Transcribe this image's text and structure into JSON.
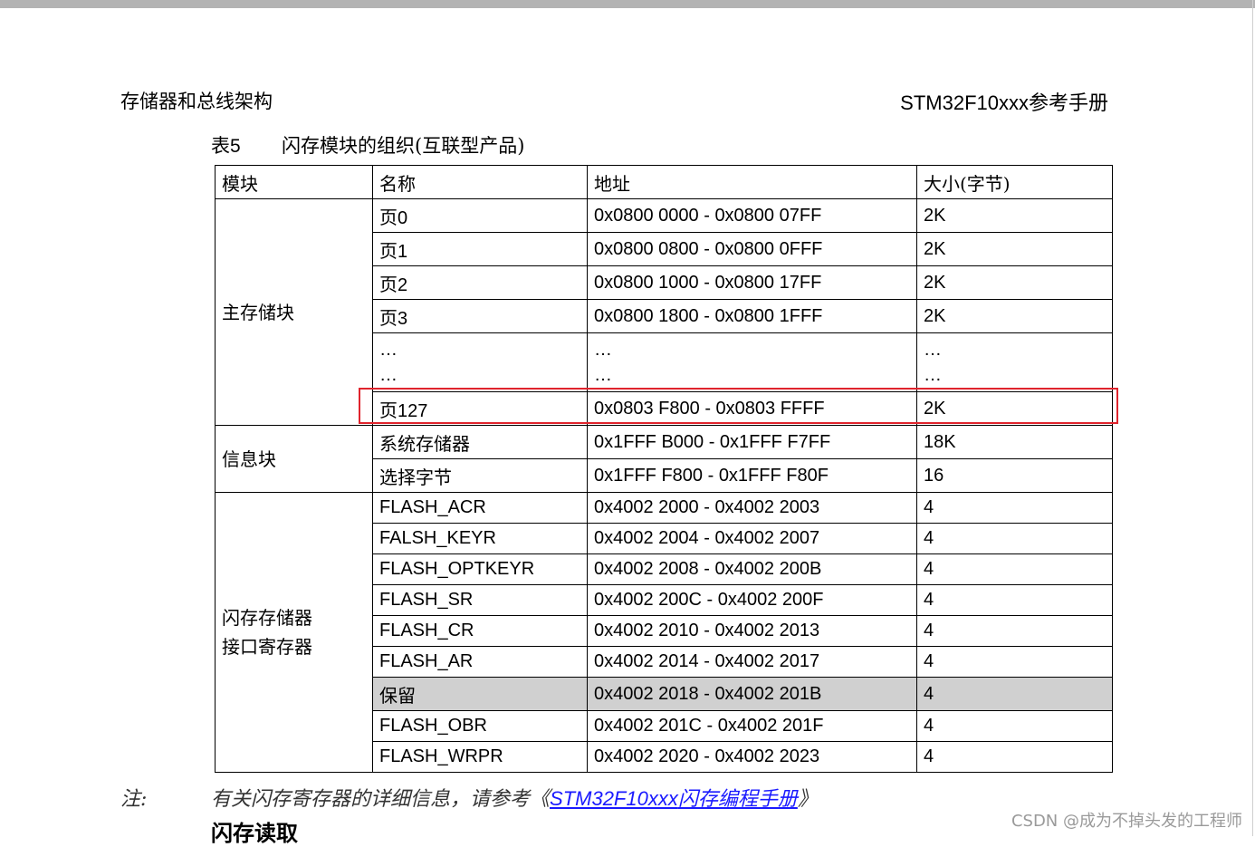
{
  "header": {
    "left": "存储器和总线架构",
    "right": "STM32F10xxx参考手册"
  },
  "caption": {
    "number": "表5",
    "title": "闪存模块的组织(互联型产品)"
  },
  "table": {
    "columns": [
      "模块",
      "名称",
      "地址",
      "大小(字节)"
    ],
    "main_block": {
      "label": "主存储块",
      "rows": [
        {
          "name": "页0",
          "addr": "0x0800 0000 - 0x0800 07FF",
          "size": "2K"
        },
        {
          "name": "页1",
          "addr": "0x0800 0800 - 0x0800 0FFF",
          "size": "2K"
        },
        {
          "name": "页2",
          "addr": "0x0800 1000 - 0x0800 17FF",
          "size": "2K"
        },
        {
          "name": "页3",
          "addr": "0x0800 1800 - 0x0800 1FFF",
          "size": "2K"
        }
      ],
      "ellipsis": "…",
      "last": {
        "name": "页127",
        "addr": "0x0803 F800 - 0x0803 FFFF",
        "size": "2K"
      }
    },
    "info_block": {
      "label": "信息块",
      "rows": [
        {
          "name": "系统存储器",
          "addr": "0x1FFF B000 - 0x1FFF F7FF",
          "size": "18K"
        },
        {
          "name": "选择字节",
          "addr": "0x1FFF F800 - 0x1FFF F80F",
          "size": "16"
        }
      ]
    },
    "reg_block": {
      "label_line1": "闪存存储器",
      "label_line2": "接口寄存器",
      "rows": [
        {
          "name": "FLASH_ACR",
          "addr": "0x4002 2000 - 0x4002 2003",
          "size": "4"
        },
        {
          "name": "FALSH_KEYR",
          "addr": "0x4002 2004 - 0x4002 2007",
          "size": "4"
        },
        {
          "name": "FLASH_OPTKEYR",
          "addr": "0x4002 2008 - 0x4002 200B",
          "size": "4"
        },
        {
          "name": "FLASH_SR",
          "addr": "0x4002 200C - 0x4002 200F",
          "size": "4"
        },
        {
          "name": "FLASH_CR",
          "addr": "0x4002 2010 - 0x4002 2013",
          "size": "4"
        },
        {
          "name": "FLASH_AR",
          "addr": "0x4002 2014 - 0x4002 2017",
          "size": "4"
        },
        {
          "name": "保留",
          "addr": "0x4002 2018 - 0x4002 201B",
          "size": "4"
        },
        {
          "name": "FLASH_OBR",
          "addr": "0x4002 201C - 0x4002 201F",
          "size": "4"
        },
        {
          "name": "FLASH_WRPR",
          "addr": "0x4002 2020 - 0x4002 2023",
          "size": "4"
        }
      ]
    }
  },
  "note": {
    "label": "注:",
    "text": "有关闪存寄存器的详细信息，请参考《",
    "link_latin": "STM32F10xxx",
    "link_cn": "闪存编程手册",
    "end": "》"
  },
  "section_title": "闪存读取",
  "watermark": "CSDN @成为不掉头发的工程师",
  "colors": {
    "highlight_box": "#e0242d",
    "reserved_fill": "#d0d0d0",
    "link": "#1a1aff"
  }
}
